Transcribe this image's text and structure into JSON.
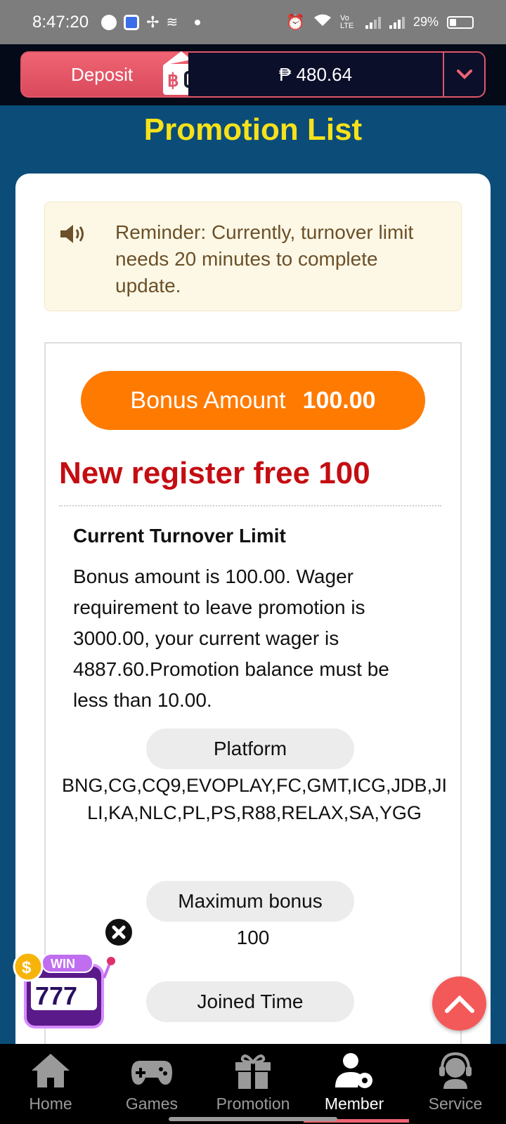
{
  "status_bar": {
    "time": "8:47:20",
    "battery": "29%",
    "network": "Vo LTE"
  },
  "header": {
    "deposit_label": "Deposit",
    "balance": "₱ 480.64"
  },
  "page": {
    "title": "Promotion List"
  },
  "reminder": {
    "text": "Reminder: Currently, turnover limit needs 20 minutes to complete update."
  },
  "promotion": {
    "bonus_label": "Bonus Amount",
    "bonus_amount": "100.00",
    "name": "New register free 100",
    "turnover_title": "Current Turnover Limit",
    "turnover_description": "Bonus amount is 100.00. Wager requirement to leave promotion is 3000.00, your current wager is 4887.60.Promotion balance must be less than 10.00.",
    "platform_label": "Platform",
    "platform_list": "BNG,CG,CQ9,EVOPLAY,FC,GMT,ICG,JDB,JILI,KA,NLC,PL,PS,R88,RELAX,SA,YGG",
    "max_bonus_label": "Maximum bonus",
    "max_bonus_value": "100",
    "joined_time_label": "Joined Time"
  },
  "floating": {
    "slot_badge": "WIN",
    "slot_reels": "777"
  },
  "bottom_nav": {
    "items": [
      {
        "label": "Home",
        "icon": "home-icon"
      },
      {
        "label": "Games",
        "icon": "gamepad-icon"
      },
      {
        "label": "Promotion",
        "icon": "gift-icon"
      },
      {
        "label": "Member",
        "icon": "member-settings-icon",
        "active": true
      },
      {
        "label": "Service",
        "icon": "headset-icon"
      }
    ]
  },
  "colors": {
    "accent_yellow": "#f7e11b",
    "bonus_orange": "#ff7a00",
    "promo_red": "#c40d12",
    "deposit_pink": "#f06473",
    "background_blue": "#0b4d78"
  }
}
